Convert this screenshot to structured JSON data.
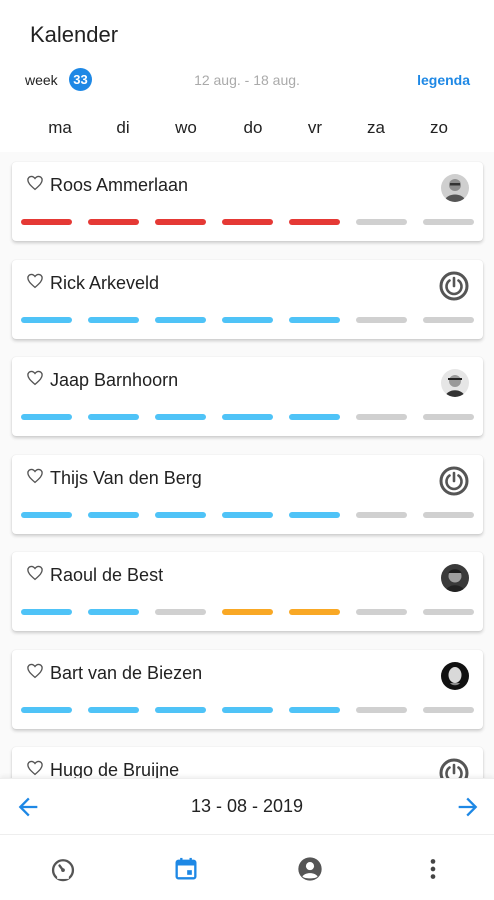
{
  "header": {
    "title": "Kalender",
    "week_label": "week",
    "week_number": "33",
    "date_range": "12 aug. - 18 aug.",
    "legend": "legenda"
  },
  "days": [
    "ma",
    "di",
    "wo",
    "do",
    "vr",
    "za",
    "zo"
  ],
  "colors": {
    "accent": "#1e88e5",
    "red": "#e53935",
    "blue": "#4fc3f7",
    "grey": "#d0d0d0",
    "orange": "#f9a825"
  },
  "people": [
    {
      "name": "Roos Ammerlaan",
      "icon": "avatar-photo",
      "bars": [
        "red",
        "red",
        "red",
        "red",
        "red",
        "grey",
        "grey"
      ]
    },
    {
      "name": "Rick Arkeveld",
      "icon": "power-icon",
      "bars": [
        "blue",
        "blue",
        "blue",
        "blue",
        "blue",
        "grey",
        "grey"
      ]
    },
    {
      "name": "Jaap Barnhoorn",
      "icon": "avatar-photo",
      "bars": [
        "blue",
        "blue",
        "blue",
        "blue",
        "blue",
        "grey",
        "grey"
      ]
    },
    {
      "name": "Thijs Van den Berg",
      "icon": "power-icon",
      "bars": [
        "blue",
        "blue",
        "blue",
        "blue",
        "blue",
        "grey",
        "grey"
      ]
    },
    {
      "name": "Raoul de Best",
      "icon": "avatar-photo",
      "bars": [
        "blue",
        "blue",
        "grey",
        "orange",
        "orange",
        "grey",
        "grey"
      ]
    },
    {
      "name": "Bart van de Biezen",
      "icon": "avatar-photo",
      "bars": [
        "blue",
        "blue",
        "blue",
        "blue",
        "blue",
        "grey",
        "grey"
      ]
    },
    {
      "name": "Hugo de Bruijne",
      "icon": "power-icon",
      "bars": [
        "blue",
        "blue",
        "blue",
        "blue",
        "blue",
        "grey",
        "grey"
      ]
    }
  ],
  "date_nav": {
    "current_date": "13 - 08 - 2019"
  },
  "bottom_nav": [
    "dashboard-icon",
    "calendar-icon",
    "account-icon",
    "more-vert-icon"
  ]
}
